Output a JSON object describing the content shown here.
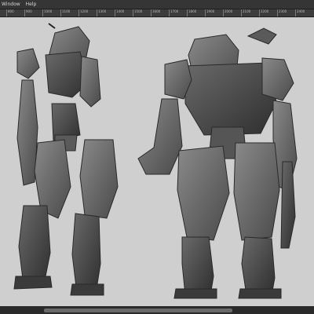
{
  "menubar": {
    "items": [
      {
        "label": "Window"
      },
      {
        "label": "Help"
      }
    ]
  },
  "ruler": {
    "ticks": [
      "800",
      "900",
      "1000",
      "1100",
      "1200",
      "1300",
      "1400",
      "1500",
      "1600",
      "1700",
      "1800",
      "1900",
      "2000",
      "2100",
      "2200",
      "2300",
      "2400"
    ]
  },
  "canvas": {
    "content": "robot-concept-sketch",
    "background": "#cfcfcf"
  },
  "scroll": {
    "horizontal_position": 0.35
  }
}
